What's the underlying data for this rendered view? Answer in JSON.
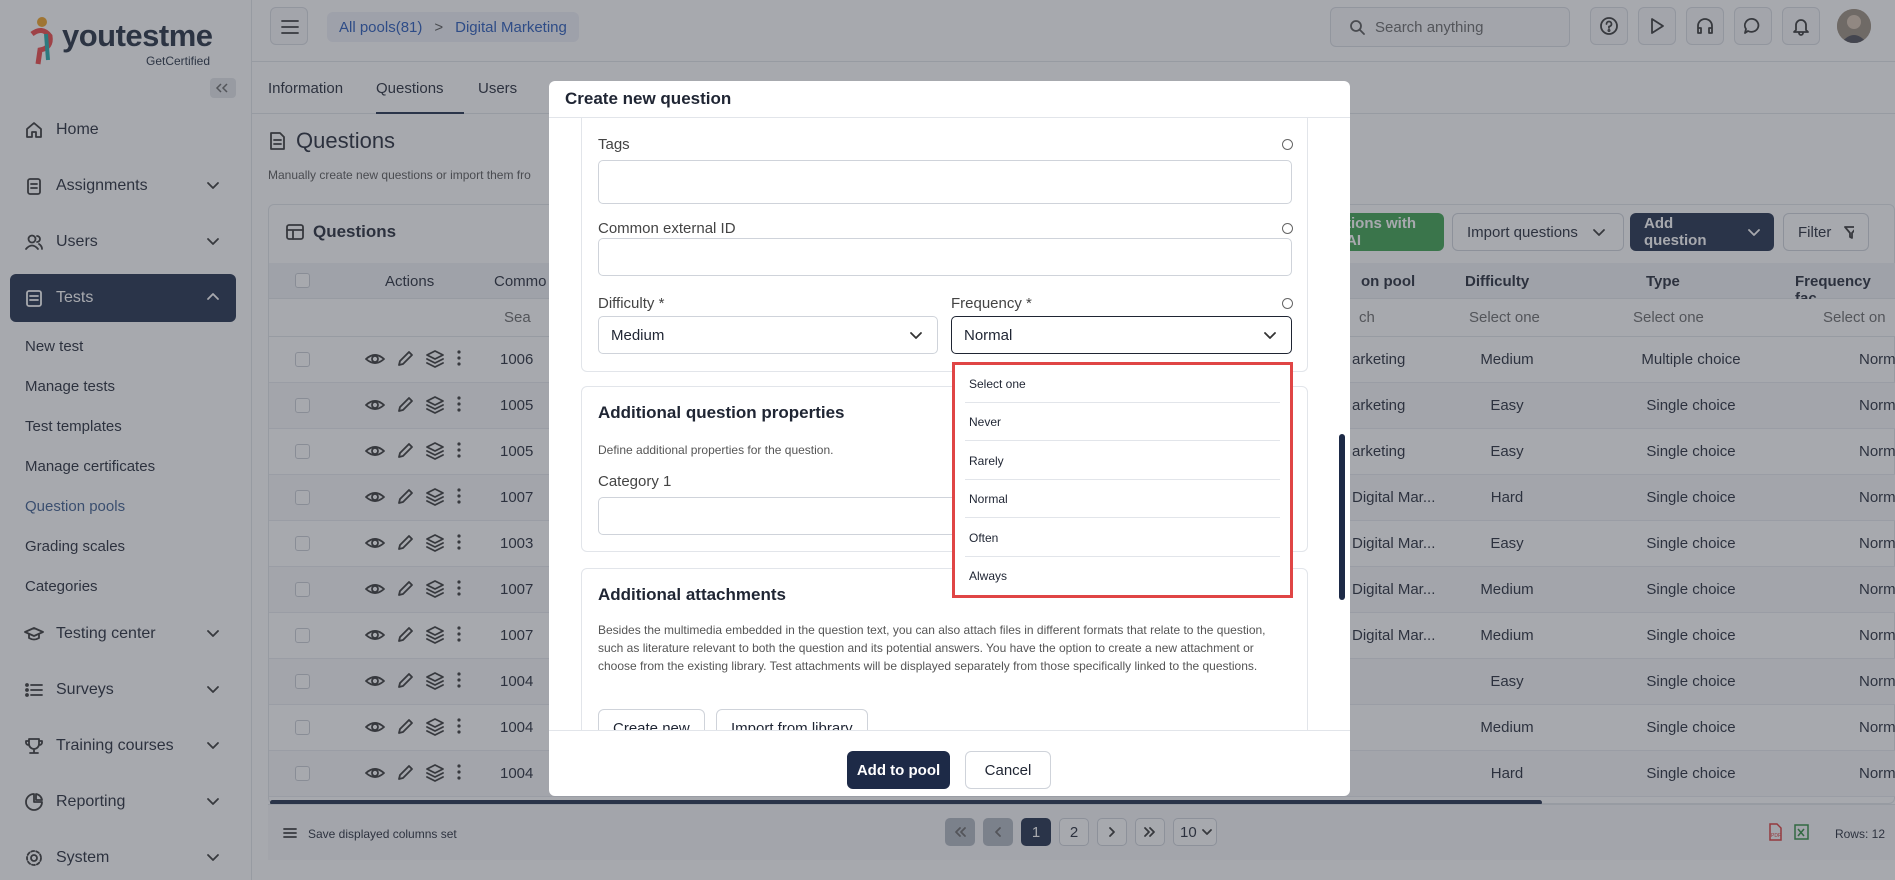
{
  "app": {
    "logo_text": "youtestme",
    "logo_sub": "GetCertified"
  },
  "sidebar": {
    "items": [
      {
        "label": "Home"
      },
      {
        "label": "Assignments"
      },
      {
        "label": "Users"
      },
      {
        "label": "Tests"
      },
      {
        "label": "Testing center"
      },
      {
        "label": "Surveys"
      },
      {
        "label": "Training courses"
      },
      {
        "label": "Reporting"
      },
      {
        "label": "System"
      }
    ],
    "tests_sub": [
      "New test",
      "Manage tests",
      "Test templates",
      "Manage certificates",
      "Question pools",
      "Grading scales",
      "Categories"
    ]
  },
  "topbar": {
    "breadcrumb_all": "All pools(81)",
    "breadcrumb_sep": ">",
    "breadcrumb_current": "Digital Marketing",
    "search_placeholder": "Search anything"
  },
  "tabs": [
    "Information",
    "Questions",
    "Users"
  ],
  "page": {
    "title": "Questions",
    "description": "Manually create new questions or import them fro",
    "panel_title": "Questions",
    "ai_button": "tions with AI",
    "import_button": "Import questions",
    "add_button": "Add question",
    "filter_button": "Filter"
  },
  "table": {
    "headers": {
      "actions": "Actions",
      "common": "Commo",
      "pool": "on pool",
      "difficulty": "Difficulty",
      "type": "Type",
      "frequency": "Frequency fac"
    },
    "filters": {
      "search": "Sea",
      "pool": "ch",
      "difficulty": "Select one",
      "type": "Select one",
      "frequency": "Select on"
    },
    "rows": [
      {
        "id": "1006",
        "pool": "arketing",
        "difficulty": "Medium",
        "type": "Multiple choice",
        "frequency": "Normal"
      },
      {
        "id": "1005",
        "pool": "arketing",
        "difficulty": "Easy",
        "type": "Single choice",
        "frequency": "Normal"
      },
      {
        "id": "1005",
        "pool": "arketing",
        "difficulty": "Easy",
        "type": "Single choice",
        "frequency": "Normal"
      },
      {
        "id": "1007",
        "pool": "Digital Mar...",
        "difficulty": "Hard",
        "type": "Single choice",
        "frequency": "Normal"
      },
      {
        "id": "1003",
        "pool": "Digital Mar...",
        "difficulty": "Easy",
        "type": "Single choice",
        "frequency": "Normal"
      },
      {
        "id": "1007",
        "pool": "Digital Mar...",
        "difficulty": "Medium",
        "type": "Single choice",
        "frequency": "Normal"
      },
      {
        "id": "1007",
        "pool": "Digital Mar...",
        "difficulty": "Medium",
        "type": "Single choice",
        "frequency": "Normal"
      },
      {
        "id": "1004",
        "pool": "",
        "difficulty": "Easy",
        "type": "Single choice",
        "frequency": "Normal"
      },
      {
        "id": "1004",
        "pool": "",
        "difficulty": "Medium",
        "type": "Single choice",
        "frequency": "Normal"
      },
      {
        "id": "1004",
        "pool": "",
        "difficulty": "Hard",
        "type": "Single choice",
        "frequency": "Normal"
      }
    ]
  },
  "footer": {
    "save_columns": "Save displayed columns set",
    "pages": [
      "1",
      "2"
    ],
    "page_size": "10",
    "rows_count": "Rows: 12"
  },
  "modal": {
    "title": "Create new question",
    "tags_label": "Tags",
    "external_id_label": "Common external ID",
    "difficulty_label": "Difficulty",
    "difficulty_value": "Medium",
    "frequency_label": "Frequency",
    "frequency_value": "Normal",
    "required_mark": "*",
    "additional_props_title": "Additional question properties",
    "additional_props_desc": "Define additional properties for the question.",
    "category_label": "Category 1",
    "attachments_title": "Additional attachments",
    "attachments_desc": "Besides the multimedia embedded in the question text, you can also attach files in different formats that relate to the question, such as literature relevant to both the question and its potential answers. You have the option to create a new attachment or choose from the existing library. Test attachments will be displayed separately from those specifically linked to the questions.",
    "create_new": "Create new",
    "import_library": "Import from library",
    "add_to_pool": "Add to pool",
    "cancel": "Cancel",
    "frequency_options": [
      "Select one",
      "Never",
      "Rarely",
      "Normal",
      "Often",
      "Always"
    ]
  }
}
